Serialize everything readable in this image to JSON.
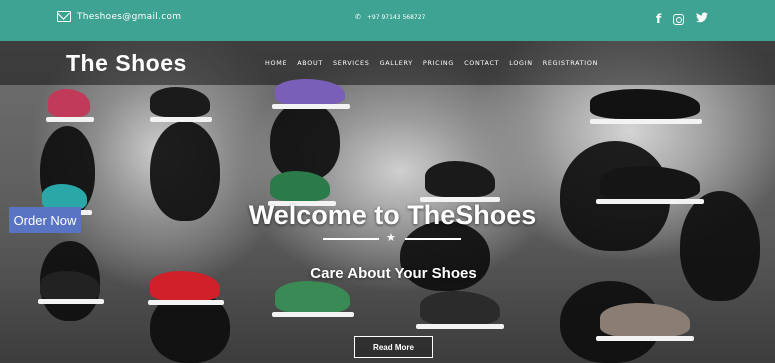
{
  "topbar": {
    "email": "Theshoes@gmail.com",
    "phone": "+97 97143 568727",
    "social": [
      "f",
      "instagram-icon",
      "twitter-icon"
    ],
    "background": "#3fa394"
  },
  "header": {
    "logo": "The Shoes",
    "nav": [
      "HOME",
      "ABOUT",
      "SERVICES",
      "GALLERY",
      "PRICING",
      "CONTACT",
      "LOGIN",
      "REGISTRATION"
    ]
  },
  "hero": {
    "order_button": "Order Now",
    "title": "Welcome to TheShoes",
    "subtitle": "Care About Your Shoes",
    "cta": "Read More",
    "order_button_color": "#5a74c4"
  }
}
